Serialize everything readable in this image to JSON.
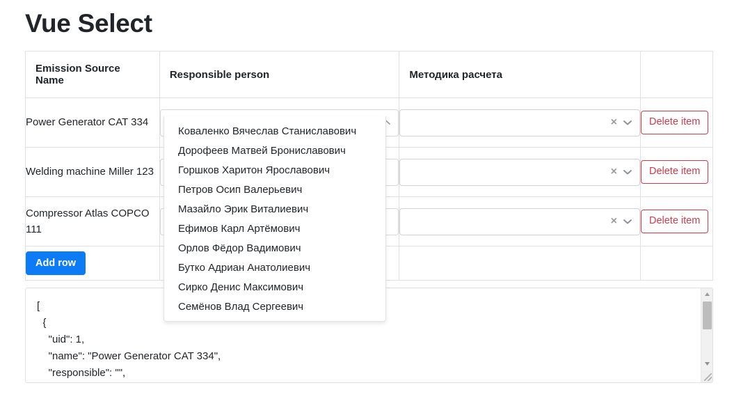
{
  "page": {
    "title": "Vue Select"
  },
  "table": {
    "headers": [
      "Emission Source Name",
      "Responsible person",
      "Методика расчета",
      ""
    ],
    "rows": [
      {
        "name": "Power Generator CAT 334",
        "responsible": "",
        "method": "",
        "delete_label": "Delete item"
      },
      {
        "name": "Welding machine Miller 123",
        "responsible": "",
        "method": "",
        "delete_label": "Delete item"
      },
      {
        "name": "Compressor Atlas COPCO 111",
        "responsible": "",
        "method": "",
        "delete_label": "Delete item"
      }
    ],
    "add_row_label": "Add row"
  },
  "dropdown": {
    "open": true,
    "input_value": "",
    "options": [
      "Коваленко Вячеслав Станиславович",
      "Дорофеев Матвей Брониславович",
      "Горшков Харитон Ярославович",
      "Петров Осип Валерьевич",
      "Мазайло Эрик Виталиевич",
      "Ефимов Карл Артёмович",
      "Орлов Фёдор Вадимович",
      "Бутко Адриан Анатолиевич",
      "Сирко Денис Максимович",
      "Семёнов Влад Сергеевич"
    ]
  },
  "method_select": {
    "clear_icon": "×",
    "caret_icon": "chevron-down"
  },
  "json_output": {
    "text": "[\n  {\n    \"uid\": 1,\n    \"name\": \"Power Generator CAT 334\",\n    \"responsible\": \"\","
  },
  "colors": {
    "primary": "#0d7bf5",
    "danger": "#dc3545",
    "text": "#212529",
    "border": "#dee2e6"
  }
}
